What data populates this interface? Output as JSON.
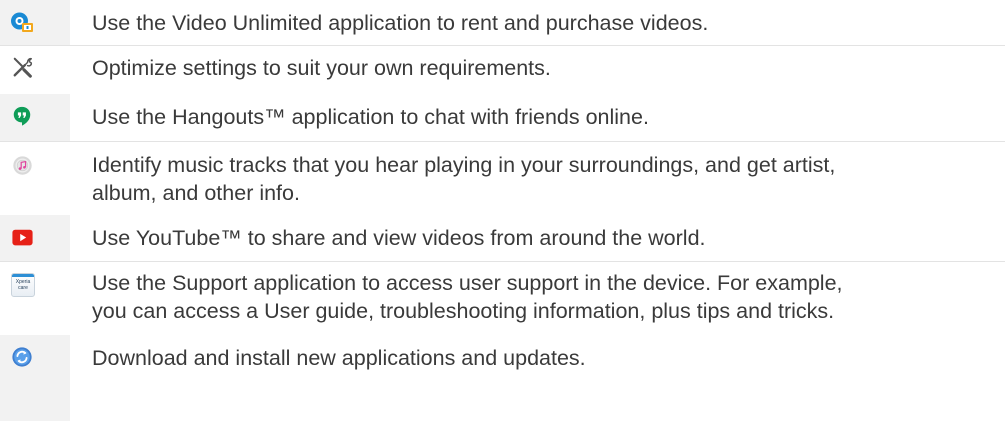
{
  "items": [
    {
      "icon": "video-unlimited-icon",
      "lines": [
        "Use the Video Unlimited application to rent and purchase videos."
      ]
    },
    {
      "icon": "settings-tools-icon",
      "lines": [
        "Optimize settings to suit your own requirements."
      ]
    },
    {
      "icon": "hangouts-icon",
      "lines": [
        "Use the Hangouts™ application to chat with friends online."
      ]
    },
    {
      "icon": "trackid-icon",
      "lines": [
        "Identify music tracks that you hear playing in your surroundings, and get artist,",
        "album, and other info."
      ]
    },
    {
      "icon": "youtube-icon",
      "lines": [
        "Use YouTube™ to share and view videos from around the world."
      ]
    },
    {
      "icon": "support-icon",
      "icon_text": "Xperia care",
      "lines": [
        "Use the Support application to access user support in the device. For example,",
        "you can access a User guide, troubleshooting information, plus tips and tricks."
      ]
    },
    {
      "icon": "download-updates-icon",
      "lines": [
        "Download and install new applications and updates."
      ]
    }
  ],
  "colors": {
    "text": "#3a3a3a",
    "icon_cell_bg": "#f2f2f2",
    "divider": "#e3e3e3",
    "youtube_red": "#e62117",
    "hangouts_green": "#0f9d58",
    "video_blue": "#1a8ad4",
    "xperia_blue": "#2d8fd5"
  }
}
